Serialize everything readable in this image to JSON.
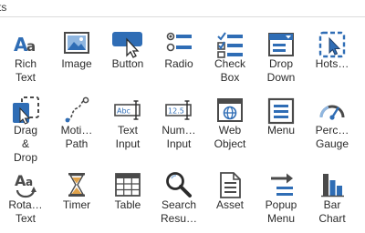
{
  "window": {
    "title_fragment": "ts"
  },
  "tools": [
    {
      "id": "rich-text",
      "label": "Rich\nText",
      "icon": "rich-text-icon"
    },
    {
      "id": "image",
      "label": "Image",
      "icon": "image-icon"
    },
    {
      "id": "button",
      "label": "Button",
      "icon": "button-icon"
    },
    {
      "id": "radio",
      "label": "Radio",
      "icon": "radio-icon"
    },
    {
      "id": "check-box",
      "label": "Check\nBox",
      "icon": "check-box-icon"
    },
    {
      "id": "drop-down",
      "label": "Drop\nDown",
      "icon": "drop-down-icon"
    },
    {
      "id": "hotspot",
      "label": "Hots…",
      "icon": "hotspot-icon"
    },
    {
      "id": "drag-drop",
      "label": "Drag\n&\nDrop",
      "icon": "drag-drop-icon"
    },
    {
      "id": "motion-path",
      "label": "Moti…\nPath",
      "icon": "motion-path-icon"
    },
    {
      "id": "text-input",
      "label": "Text\nInput",
      "icon": "text-input-icon"
    },
    {
      "id": "numeric-input",
      "label": "Num…\nInput",
      "icon": "numeric-input-icon"
    },
    {
      "id": "web-object",
      "label": "Web\nObject",
      "icon": "web-object-icon"
    },
    {
      "id": "menu",
      "label": "Menu",
      "icon": "menu-icon"
    },
    {
      "id": "percent-gauge",
      "label": "Perc…\nGauge",
      "icon": "gauge-icon"
    },
    {
      "id": "rotate-text",
      "label": "Rota…\nText",
      "icon": "rotate-text-icon"
    },
    {
      "id": "timer",
      "label": "Timer",
      "icon": "hourglass-icon"
    },
    {
      "id": "table",
      "label": "Table",
      "icon": "table-icon"
    },
    {
      "id": "search-results",
      "label": "Search\nResu…",
      "icon": "search-icon"
    },
    {
      "id": "asset",
      "label": "Asset",
      "icon": "document-icon"
    },
    {
      "id": "popup-menu",
      "label": "Popup\nMenu",
      "icon": "popup-menu-icon"
    },
    {
      "id": "bar-chart",
      "label": "Bar\nChart",
      "icon": "bar-chart-icon"
    }
  ],
  "colors": {
    "blue": "#2f6db5",
    "dark": "#4a4a4a",
    "light_blue": "#8fb6e0"
  }
}
